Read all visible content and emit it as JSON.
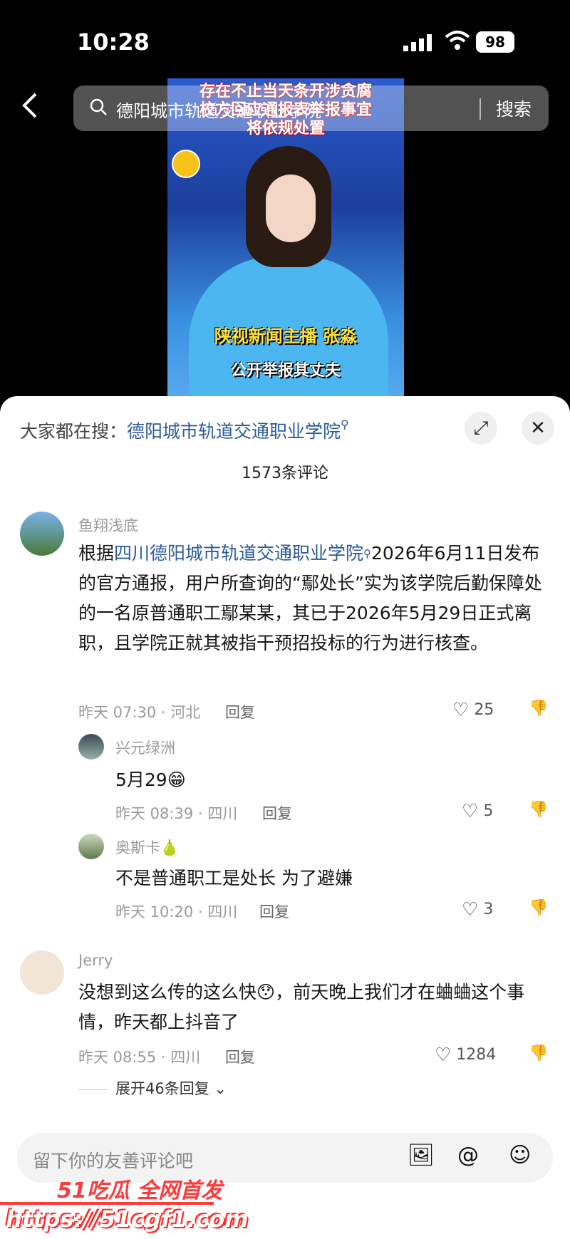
{
  "status": {
    "time": "10:28",
    "battery": "98"
  },
  "video": {
    "headline_lines": [
      "存在不止当天条开涉贪腐",
      "校方回应通报表举报事宜",
      "将依规处置"
    ],
    "caption_yellow": "陕视新闻主播 张淼",
    "caption_white": "公开举报其丈夫"
  },
  "search": {
    "query": "德阳城市轨道交通职业学院",
    "button": "搜索"
  },
  "comments_panel": {
    "trending_prefix": "大家都在搜：",
    "trending_link": "德阳城市轨道交通职业学院",
    "count": "1573条评论",
    "comments": [
      {
        "author": "鱼翔浅底",
        "text_prefix": "根据",
        "text_link": "四川德阳城市轨道交通职业学院",
        "text_rest": "2026年6月11日发布的官方通报，用户所查询的“鄢处长”实为该学院后勤保障处的一名原普通职工鄢某某，其已于2026年5月29日正式离职，且学院正就其被指干预招投标的行为进行核查。",
        "meta": "昨天 07:30 · 河北",
        "reply": "回复",
        "likes": "25",
        "replies": [
          {
            "author": "兴元绿洲",
            "text": "5月29😁",
            "meta": "昨天 08:39 · 四川",
            "reply": "回复",
            "likes": "5"
          },
          {
            "author": "奥斯卡🍐",
            "text": "不是普通职工是处长 为了避嫌",
            "meta": "昨天 10:20 · 四川",
            "reply": "回复",
            "likes": "3"
          }
        ]
      },
      {
        "author": "Jerry",
        "text": "没想到这么传的这么快😯，前天晚上我们才在蛐蛐这个事情，昨天都上抖音了",
        "meta": "昨天 08:55 · 四川",
        "reply": "回复",
        "likes": "1284",
        "expand": "展开46条回复"
      }
    ]
  },
  "input": {
    "placeholder": "留下你的友善评论吧"
  },
  "watermark": {
    "line1": "51吃瓜 全网首发",
    "line2": "https://51cgf1.com"
  },
  "icons": [
    "back-icon",
    "search-icon",
    "collapse-icon",
    "close-icon",
    "heart-icon",
    "dislike-icon",
    "image-icon",
    "at-icon",
    "emoji-icon",
    "chevron-down-icon"
  ]
}
